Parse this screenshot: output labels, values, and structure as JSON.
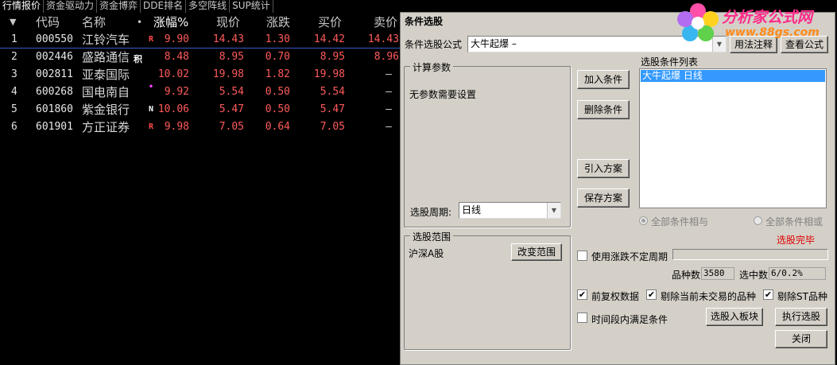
{
  "tabs": [
    "行情报价",
    "资金驱动力",
    "资金博弈",
    "DDE排名",
    "多空阵线",
    "SUP统计"
  ],
  "table": {
    "headers": {
      "sort_icon": "▼",
      "code": "代码",
      "name": "名称",
      "dot": "•",
      "change_pct": "涨幅%",
      "price": "现价",
      "change": "涨跌",
      "bid": "买价",
      "ask": "卖价"
    },
    "rows": [
      {
        "idx": "1",
        "code": "000550",
        "name": "江铃汽车",
        "flag": "R",
        "change_pct": "9.90",
        "price": "14.43",
        "change": "1.30",
        "bid": "14.42",
        "ask": "14.43"
      },
      {
        "idx": "2",
        "code": "002446",
        "name": "盛路通信",
        "flag": "积",
        "change_pct": "8.48",
        "price": "8.95",
        "change": "0.70",
        "bid": "8.95",
        "ask": "8.96"
      },
      {
        "idx": "3",
        "code": "002811",
        "name": "亚泰国际",
        "flag": "",
        "change_pct": "10.02",
        "price": "19.98",
        "change": "1.82",
        "bid": "19.98",
        "ask": "–"
      },
      {
        "idx": "4",
        "code": "600268",
        "name": "国电南自",
        "flag": "•",
        "change_pct": "9.92",
        "price": "5.54",
        "change": "0.50",
        "bid": "5.54",
        "ask": "–"
      },
      {
        "idx": "5",
        "code": "601860",
        "name": "紫金银行",
        "flag": "N",
        "change_pct": "10.06",
        "price": "5.47",
        "change": "0.50",
        "bid": "5.47",
        "ask": "–"
      },
      {
        "idx": "6",
        "code": "601901",
        "name": "方正证券",
        "flag": "R",
        "change_pct": "9.98",
        "price": "7.05",
        "change": "0.64",
        "bid": "7.05",
        "ask": "–"
      }
    ]
  },
  "logo": {
    "title": "分析家公式网",
    "url": "www.88gs.com"
  },
  "dialog": {
    "title": "条件选股",
    "formula_label": "条件选股公式",
    "formula_value": "大牛起爆    –",
    "usage_button": "用法注释",
    "view_formula_button": "查看公式",
    "params_group": "计算参数",
    "params_text": "无参数需要设置",
    "period_label": "选股周期:",
    "period_value": "日线",
    "add_condition": "加入条件",
    "delete_condition": "删除条件",
    "import_plan": "引入方案",
    "save_plan": "保存方案",
    "condition_list_label": "选股条件列表",
    "condition_items": [
      "大牛起爆  日线"
    ],
    "radio_and": "全部条件相与",
    "radio_or": "全部条件相或",
    "status": "选股完毕",
    "scope_group": "选股范围",
    "scope_value": "沪深A股",
    "change_scope": "改变范围",
    "use_period_label": "使用涨跌不定周期",
    "count_label": "品种数",
    "count_value": "3580",
    "selected_label": "选中数",
    "selected_value": "6/0.2%",
    "cb_prefq": "前复权数据",
    "cb_exclude_untraded": "剔除当前未交易的品种",
    "cb_exclude_st": "剔除ST品种",
    "cb_time_range": "时间段内满足条件",
    "to_board": "选股入板块",
    "execute": "执行选股",
    "close": "关闭"
  }
}
